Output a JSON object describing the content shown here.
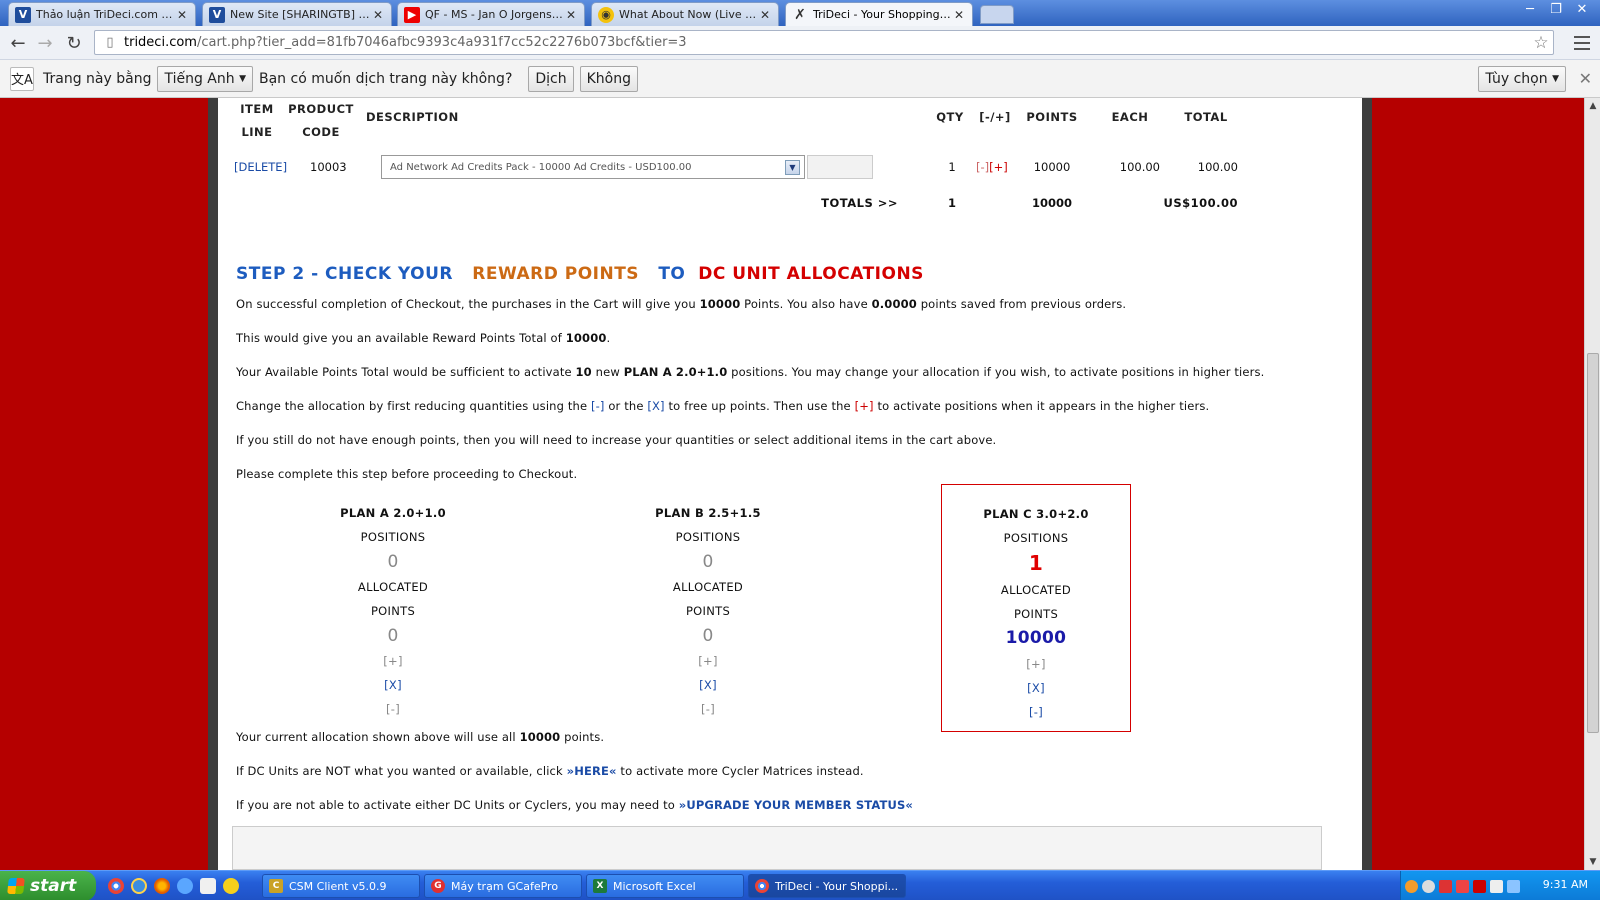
{
  "browser": {
    "tabs": [
      {
        "title": "Thảo luận TriDeci.com - Depo",
        "favicon": "trideci-icon",
        "active": false
      },
      {
        "title": "New Site [SHARINGTB] Bank",
        "favicon": "trideci-icon",
        "active": false
      },
      {
        "title": "QF - MS - Jan O Jorgensen v",
        "favicon": "youtube-icon",
        "active": false
      },
      {
        "title": "What About Now (Live From",
        "favicon": "music-icon",
        "active": false
      },
      {
        "title": "TriDeci - Your Shopping Cart",
        "favicon": "trideci-x-icon",
        "active": true
      }
    ],
    "url_host": "trideci.com",
    "url_path": "/cart.php?tier_add=81fb7046afbc9393c4a931f7cc52c2276b073bcf&tier=3"
  },
  "translate_bar": {
    "prefix": "Trang này bằng",
    "language": "Tiếng Anh",
    "question": "Bạn có muốn dịch trang này không?",
    "translate_button": "Dịch",
    "no_button": "Không",
    "options_button": "Tùy chọn"
  },
  "cart": {
    "headers": {
      "item_line_1": "ITEM",
      "item_line_2": "LINE",
      "product_code_1": "PRODUCT",
      "product_code_2": "CODE",
      "description": "DESCRIPTION",
      "qty": "QTY",
      "adjust": "[-/+]",
      "points": "POINTS",
      "each": "EACH",
      "total": "TOTAL"
    },
    "row": {
      "delete": "[DELETE]",
      "code": "10003",
      "description": "Ad Network Ad Credits Pack - 10000 Ad Credits - USD100.00",
      "qty": "1",
      "minus": "[-]",
      "plus": "[+]",
      "points": "10000",
      "each": "100.00",
      "total": "100.00"
    },
    "totals": {
      "label": "TOTALS >>",
      "qty": "1",
      "points": "10000",
      "amount": "US$100.00"
    }
  },
  "step2": {
    "part1": "STEP 2 - CHECK YOUR",
    "part2": "REWARD POINTS",
    "part3": "TO",
    "part4": "DC UNIT ALLOCATIONS",
    "p1": {
      "a": "On successful completion of Checkout, the purchases in the Cart will give you ",
      "b": "10000",
      "c": " Points. You also have ",
      "d": "0.0000",
      "e": " points saved from previous orders."
    },
    "p2": {
      "a": "This would give you an available Reward Points Total of ",
      "b": "10000",
      "c": "."
    },
    "p3": {
      "a": "Your Available Points Total would be sufficient to activate ",
      "b": "10",
      "c": " new ",
      "d": "PLAN A 2.0+1.0",
      "e": " positions. You may change your allocation if you wish, to activate positions in higher tiers."
    },
    "p4": {
      "a": "Change the allocation by first reducing quantities using the ",
      "b": "[-]",
      "c": " or the ",
      "d": "[X]",
      "e": " to free up points. Then use the ",
      "f": "[+]",
      "g": " to activate positions when it appears in the higher tiers."
    },
    "p5": "If you still do not have enough points, then you will need to increase your quantities or select additional items in the cart above.",
    "p6": "Please complete this step before proceeding to Checkout.",
    "p7": {
      "a": "Your current allocation shown above will use all ",
      "b": "10000",
      "c": " points."
    },
    "p8": {
      "a": "If DC Units are NOT what you wanted or available, click ",
      "b": "»HERE«",
      "c": " to activate more Cycler Matrices instead."
    },
    "p9": {
      "a": "If you are not able to activate either DC Units or Cyclers, you may need to ",
      "b": "»UPGRADE YOUR MEMBER STATUS«"
    }
  },
  "plans": [
    {
      "name": "PLAN A 2.0+1.0",
      "positions_label": "POSITIONS",
      "positions": "0",
      "allocated_label": "ALLOCATED",
      "points_label": "POINTS",
      "points": "0",
      "plus": "[+]",
      "x": "[X]",
      "minus": "[-]"
    },
    {
      "name": "PLAN B 2.5+1.5",
      "positions_label": "POSITIONS",
      "positions": "0",
      "allocated_label": "ALLOCATED",
      "points_label": "POINTS",
      "points": "0",
      "plus": "[+]",
      "x": "[X]",
      "minus": "[-]"
    },
    {
      "name": "PLAN C 3.0+2.0",
      "positions_label": "POSITIONS",
      "positions": "1",
      "allocated_label": "ALLOCATED",
      "points_label": "POINTS",
      "points": "10000",
      "plus": "[+]",
      "x": "[X]",
      "minus": "[-]"
    }
  ],
  "taskbar": {
    "start": "start",
    "tasks": [
      {
        "title": "CSM Client v5.0.9",
        "icon": "csm-icon"
      },
      {
        "title": "Máy trạm GCafePro",
        "icon": "gcafe-icon"
      },
      {
        "title": "Microsoft Excel",
        "icon": "excel-icon"
      },
      {
        "title": "TriDeci - Your Shoppi...",
        "icon": "chrome-icon"
      }
    ],
    "clock": "9:31 AM"
  },
  "colors": {
    "page_bg": "#b50000",
    "blue_heading": "#1d5cbf",
    "orange_heading": "#cc6a14",
    "red_heading": "#d40000",
    "link": "#1a4ba6"
  }
}
